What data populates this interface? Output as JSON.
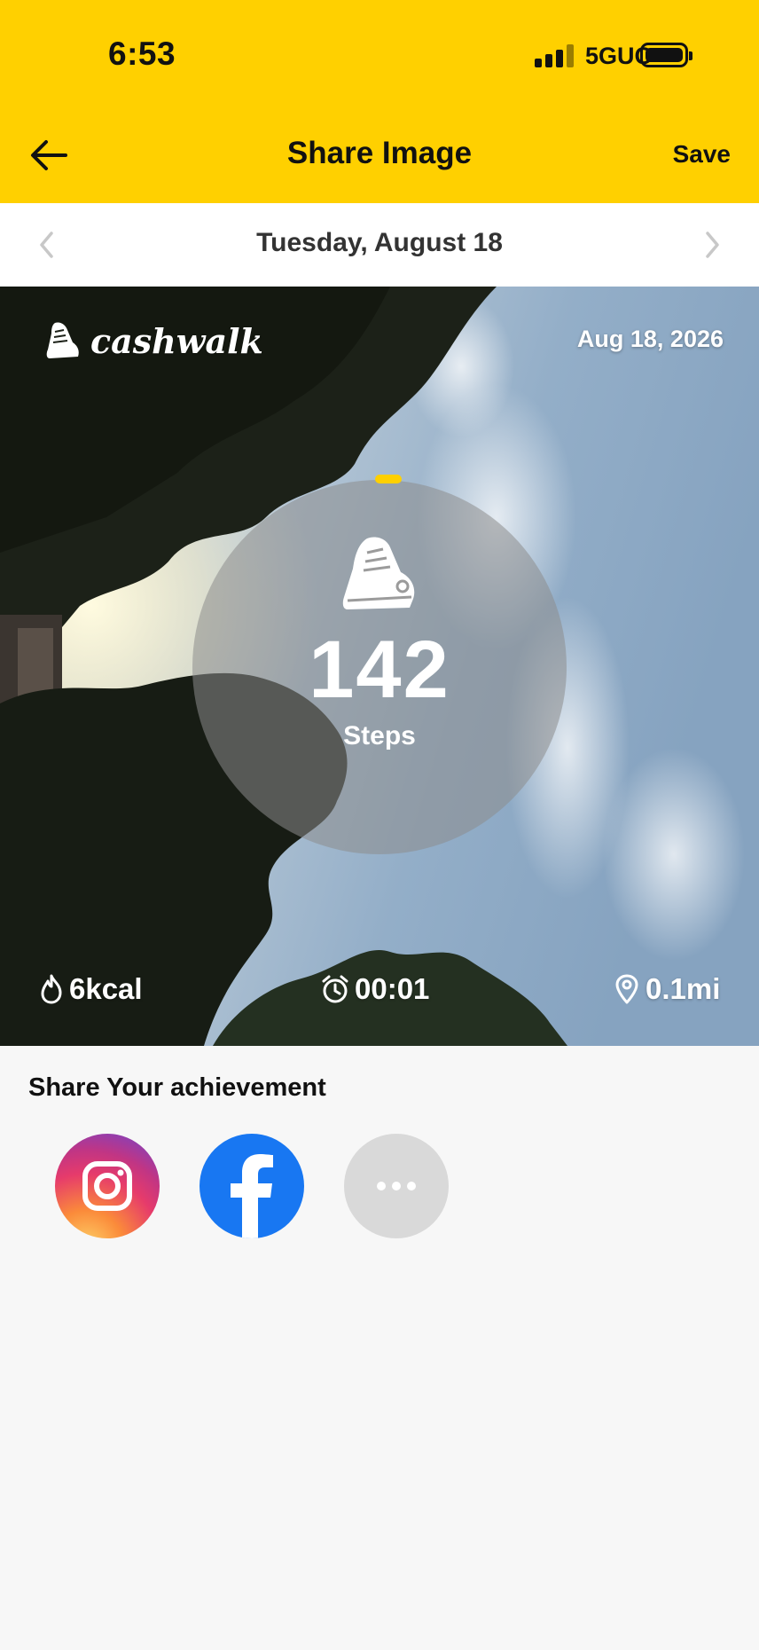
{
  "status_bar": {
    "time": "6:53",
    "network": "5GUC"
  },
  "header": {
    "title": "Share Image",
    "save_label": "Save"
  },
  "date_nav": {
    "date": "Tuesday, August 18"
  },
  "card": {
    "brand": "cashwalk",
    "date": "Aug 18, 2026",
    "steps_value": "142",
    "steps_label": "Steps",
    "stats": {
      "calories": "6kcal",
      "duration": "00:01",
      "distance": "0.1mi"
    }
  },
  "share": {
    "title": "Share Your achievement",
    "options": [
      "instagram-icon",
      "facebook-icon",
      "more-icon"
    ]
  },
  "colors": {
    "accent": "#ffd000",
    "facebook": "#1877f2"
  }
}
